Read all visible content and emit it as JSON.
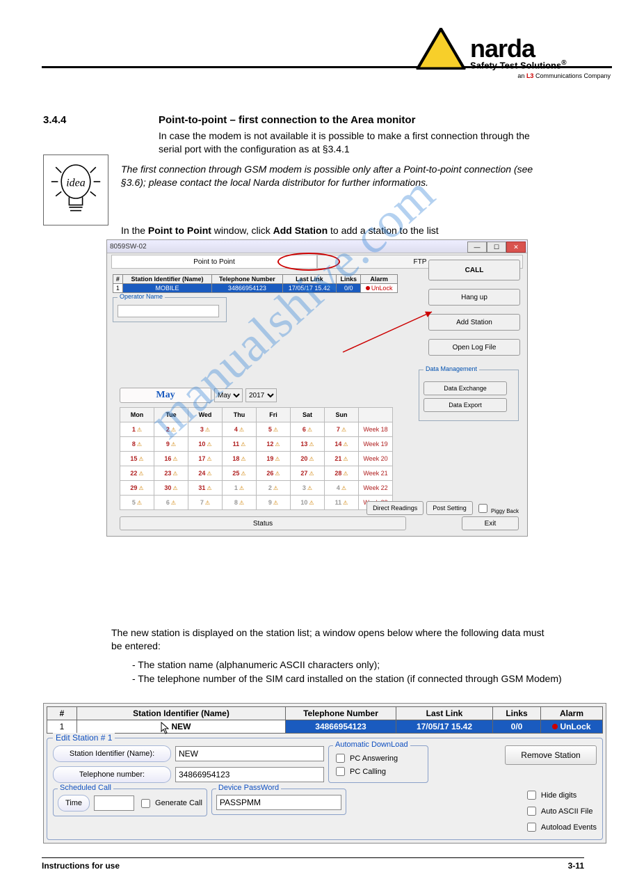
{
  "header": {
    "brand_main": "narda",
    "brand_sub": "Safety Test Solutions",
    "reg": "®",
    "tagline_pre": "an ",
    "tagline_l3": "L3",
    "tagline_post": " Communications Company"
  },
  "idea_label": "idea",
  "section": {
    "num1": "3.4.4",
    "title1": "Point-to-point – first connection to the Area monitor",
    "p1": "In case the modem is not available it is possible to make a first connection through the serial port with the configuration as at §3.4.1",
    "note_it": "The first connection through GSM modem is possible only after a Point-to-point connection (see §3.6); please contact the local Narda distributor for further informations.",
    "p2a": "In the ",
    "p2b": "Point to Point",
    "p2c": " window, click ",
    "p2d": "Add Station",
    "p2e": " to add a station to the list"
  },
  "win1": {
    "title": "8059SW-02",
    "tab_active": "Point to Point",
    "tab_other": "FTP",
    "grid": {
      "headers": [
        "#",
        "Station Identifier (Name)",
        "Telephone Number",
        "Last Link",
        "Links",
        "Alarm"
      ],
      "row": {
        "idx": "1",
        "name": "MOBILE",
        "phone": "34866954123",
        "link": "17/05/17 15.42",
        "links": "0/0",
        "alarm": "UnLock"
      }
    },
    "operator_label": "Operator Name",
    "buttons": {
      "call": "CALL",
      "hangup": "Hang up",
      "add": "Add Station",
      "openlog": "Open Log File"
    },
    "datamgmt": {
      "title": "Data Management",
      "exchange": "Data Exchange",
      "export": "Data Export"
    },
    "calendar": {
      "month": "May",
      "year": "2017",
      "dow": [
        "Mon",
        "Tue",
        "Wed",
        "Thu",
        "Fri",
        "Sat",
        "Sun"
      ],
      "weeks": [
        {
          "wk": "Week 18",
          "days": [
            {
              "n": "1"
            },
            {
              "n": "2"
            },
            {
              "n": "3"
            },
            {
              "n": "4"
            },
            {
              "n": "5"
            },
            {
              "n": "6"
            },
            {
              "n": "7"
            }
          ]
        },
        {
          "wk": "Week 19",
          "days": [
            {
              "n": "8"
            },
            {
              "n": "9"
            },
            {
              "n": "10"
            },
            {
              "n": "11"
            },
            {
              "n": "12"
            },
            {
              "n": "13"
            },
            {
              "n": "14"
            }
          ]
        },
        {
          "wk": "Week 20",
          "days": [
            {
              "n": "15"
            },
            {
              "n": "16"
            },
            {
              "n": "17"
            },
            {
              "n": "18"
            },
            {
              "n": "19"
            },
            {
              "n": "20"
            },
            {
              "n": "21"
            }
          ]
        },
        {
          "wk": "Week 21",
          "days": [
            {
              "n": "22"
            },
            {
              "n": "23"
            },
            {
              "n": "24"
            },
            {
              "n": "25"
            },
            {
              "n": "26"
            },
            {
              "n": "27"
            },
            {
              "n": "28"
            }
          ]
        },
        {
          "wk": "Week 22",
          "days": [
            {
              "n": "29"
            },
            {
              "n": "30"
            },
            {
              "n": "31"
            },
            {
              "n": "1",
              "g": true
            },
            {
              "n": "2",
              "g": true
            },
            {
              "n": "3",
              "g": true
            },
            {
              "n": "4",
              "g": true
            }
          ]
        },
        {
          "wk": "Week 23",
          "days": [
            {
              "n": "5",
              "g": true
            },
            {
              "n": "6",
              "g": true
            },
            {
              "n": "7",
              "g": true
            },
            {
              "n": "8",
              "g": true
            },
            {
              "n": "9",
              "g": true
            },
            {
              "n": "10",
              "g": true
            },
            {
              "n": "11",
              "g": true
            }
          ]
        }
      ]
    },
    "status": "Status",
    "direct": "Direct Readings",
    "post": "Post Setting",
    "piggy": "Piggy Back",
    "exit": "Exit"
  },
  "mid_text": {
    "p3": "The new station is displayed on the station list; a window opens below where the following data must be entered:",
    "b1": " The station name (alphanumeric ASCII characters only);",
    "b2": " The telephone number of the SIM card installed on the station (if connected through GSM Modem)"
  },
  "win2": {
    "headers": [
      "#",
      "Station Identifier (Name)",
      "Telephone Number",
      "Last Link",
      "Links",
      "Alarm"
    ],
    "row": {
      "idx": "1",
      "name": "NEW",
      "phone": "34866954123",
      "link": "17/05/17 15.42",
      "links": "0/0",
      "alarm": "UnLock"
    },
    "edit_legend": "Edit Station # 1",
    "lbl_sid": "Station Identifier (Name):",
    "val_sid": "NEW",
    "lbl_phone": "Telephone number:",
    "val_phone": "34866954123",
    "auto_legend": "Automatic DownLoad",
    "auto_pca": "PC Answering",
    "auto_pcc": "PC Calling",
    "remove": "Remove Station",
    "sched_legend": "Scheduled Call",
    "time": "Time",
    "gencall": "Generate Call",
    "devpw_legend": "Device PassWord",
    "devpw_val": "PASSPMM",
    "hide": "Hide digits",
    "ascii": "Auto ASCII File",
    "autoload": "Autoload Events"
  },
  "footer": {
    "left": "Instructions for use",
    "right": "3-11"
  },
  "watermark": "manualshive.com"
}
